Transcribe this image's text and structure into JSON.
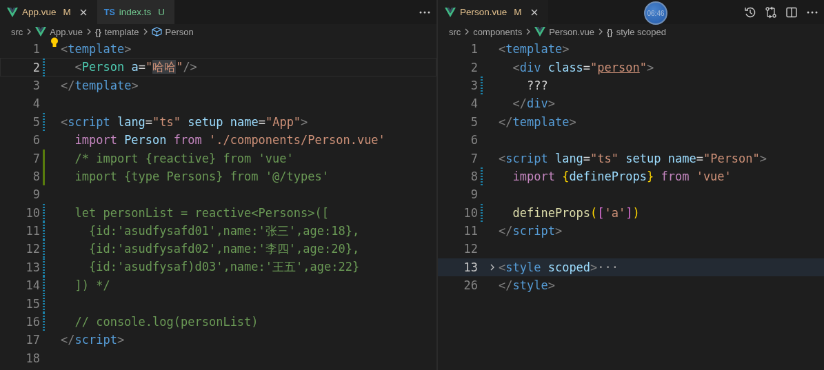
{
  "panes": [
    {
      "tabs": [
        {
          "kind": "vue",
          "label": "App.vue",
          "status": "M",
          "selected": true
        },
        {
          "kind": "ts",
          "icon_label": "TS",
          "label": "index.ts",
          "status": "U",
          "selected": false
        }
      ],
      "actions": [
        {
          "kind": "more"
        }
      ],
      "breadcrumbs": [
        {
          "kind": "folder",
          "text": "src"
        },
        {
          "kind": "vue",
          "text": "App.vue"
        },
        {
          "kind": "symbol",
          "symbol": "{}",
          "text": "template"
        },
        {
          "kind": "component",
          "text": "Person"
        }
      ],
      "lines": [
        {
          "number": "1",
          "lightbulb": true,
          "tokens": [
            {
              "text": "<",
              "kind": "punct"
            },
            {
              "text": "template",
              "kind": "tag"
            },
            {
              "text": ">",
              "kind": "punct"
            }
          ]
        },
        {
          "number": "2",
          "current": true,
          "git_modified": true,
          "tokens": [
            {
              "text": "  <",
              "kind": "punct"
            },
            {
              "text": "Person",
              "kind": "component"
            },
            {
              "text": " a",
              "kind": "attr"
            },
            {
              "text": "=",
              "kind": "plain"
            },
            {
              "text": "\"",
              "kind": "str"
            },
            {
              "text": "哈哈",
              "kind": "strhl"
            },
            {
              "text": "\"",
              "kind": "str"
            },
            {
              "text": "/>",
              "kind": "punct"
            }
          ]
        },
        {
          "number": "3",
          "tokens": [
            {
              "text": "</",
              "kind": "punct"
            },
            {
              "text": "template",
              "kind": "tag"
            },
            {
              "text": ">",
              "kind": "punct"
            }
          ]
        },
        {
          "number": "4"
        },
        {
          "number": "5",
          "git_modified": true,
          "tokens": [
            {
              "text": "<",
              "kind": "punct"
            },
            {
              "text": "script",
              "kind": "tag"
            },
            {
              "text": " lang",
              "kind": "attr"
            },
            {
              "text": "=",
              "kind": "plain"
            },
            {
              "text": "\"ts\"",
              "kind": "str"
            },
            {
              "text": " setup",
              "kind": "attr"
            },
            {
              "text": " name",
              "kind": "attr"
            },
            {
              "text": "=",
              "kind": "plain"
            },
            {
              "text": "\"App\"",
              "kind": "str"
            },
            {
              "text": ">",
              "kind": "punct"
            }
          ]
        },
        {
          "number": "6",
          "tokens": [
            {
              "text": "  import",
              "kind": "kw"
            },
            {
              "text": " Person",
              "kind": "ident"
            },
            {
              "text": " from",
              "kind": "kw"
            },
            {
              "text": " './components/Person.vue'",
              "kind": "str"
            }
          ]
        },
        {
          "number": "7",
          "git_added": true,
          "tokens": [
            {
              "text": "  /* import {reactive} from 'vue'",
              "kind": "comment"
            }
          ]
        },
        {
          "number": "8",
          "git_added": true,
          "tokens": [
            {
              "text": "  import {type Persons} from '@/types'",
              "kind": "comment"
            }
          ]
        },
        {
          "number": "9"
        },
        {
          "number": "10",
          "git_modified": true,
          "tokens": [
            {
              "text": "  let personList = reactive<Persons>([",
              "kind": "comment"
            }
          ]
        },
        {
          "number": "11",
          "git_modified": true,
          "tokens": [
            {
              "text": "    {id:'asudfysafd01',name:'张三',age:18},",
              "kind": "comment"
            }
          ]
        },
        {
          "number": "12",
          "git_modified": true,
          "tokens": [
            {
              "text": "    {id:'asudfysafd02',name:'李四',age:20},",
              "kind": "comment"
            }
          ]
        },
        {
          "number": "13",
          "git_modified": true,
          "tokens": [
            {
              "text": "    {id:'asudfysaf)d03',name:'王五',age:22}",
              "kind": "comment"
            }
          ]
        },
        {
          "number": "14",
          "git_modified": true,
          "tokens": [
            {
              "text": "  ]) */",
              "kind": "comment"
            }
          ]
        },
        {
          "number": "15",
          "git_modified": true
        },
        {
          "number": "16",
          "git_modified": true,
          "tokens": [
            {
              "text": "  // console.log(personList)",
              "kind": "comment"
            }
          ]
        },
        {
          "number": "17",
          "tokens": [
            {
              "text": "</",
              "kind": "punct"
            },
            {
              "text": "script",
              "kind": "tag"
            },
            {
              "text": ">",
              "kind": "punct"
            }
          ]
        },
        {
          "number": "18"
        }
      ]
    },
    {
      "tabs": [
        {
          "kind": "vue",
          "label": "Person.vue",
          "status": "M",
          "selected": true
        }
      ],
      "actions": [
        {
          "kind": "history"
        },
        {
          "kind": "compare"
        },
        {
          "kind": "split"
        },
        {
          "kind": "more"
        }
      ],
      "timer": "06:46",
      "breadcrumbs": [
        {
          "kind": "folder",
          "text": "src"
        },
        {
          "kind": "folder",
          "text": "components"
        },
        {
          "kind": "vue",
          "text": "Person.vue"
        },
        {
          "kind": "symbol",
          "symbol": "{}",
          "text": "style scoped"
        }
      ],
      "lines": [
        {
          "number": "1",
          "tokens": [
            {
              "text": "<",
              "kind": "punct"
            },
            {
              "text": "template",
              "kind": "tag"
            },
            {
              "text": ">",
              "kind": "punct"
            }
          ]
        },
        {
          "number": "2",
          "tokens": [
            {
              "text": "  <",
              "kind": "punct"
            },
            {
              "text": "div",
              "kind": "tag"
            },
            {
              "text": " class",
              "kind": "attr"
            },
            {
              "text": "=",
              "kind": "plain"
            },
            {
              "text": "\"",
              "kind": "str"
            },
            {
              "text": "person",
              "kind": "strlink"
            },
            {
              "text": "\"",
              "kind": "str"
            },
            {
              "text": ">",
              "kind": "punct"
            }
          ]
        },
        {
          "number": "3",
          "git_modified": true,
          "tokens": [
            {
              "text": "    ???",
              "kind": "plain"
            }
          ]
        },
        {
          "number": "4",
          "tokens": [
            {
              "text": "  </",
              "kind": "punct"
            },
            {
              "text": "div",
              "kind": "tag"
            },
            {
              "text": ">",
              "kind": "punct"
            }
          ]
        },
        {
          "number": "5",
          "tokens": [
            {
              "text": "</",
              "kind": "punct"
            },
            {
              "text": "template",
              "kind": "tag"
            },
            {
              "text": ">",
              "kind": "punct"
            }
          ]
        },
        {
          "number": "6"
        },
        {
          "number": "7",
          "tokens": [
            {
              "text": "<",
              "kind": "punct"
            },
            {
              "text": "script",
              "kind": "tag"
            },
            {
              "text": " lang",
              "kind": "attr"
            },
            {
              "text": "=",
              "kind": "plain"
            },
            {
              "text": "\"ts\"",
              "kind": "str"
            },
            {
              "text": " setup",
              "kind": "attr"
            },
            {
              "text": " name",
              "kind": "attr"
            },
            {
              "text": "=",
              "kind": "plain"
            },
            {
              "text": "\"Person\"",
              "kind": "str"
            },
            {
              "text": ">",
              "kind": "punct"
            }
          ]
        },
        {
          "number": "8",
          "git_modified": true,
          "tokens": [
            {
              "text": "  import",
              "kind": "kw"
            },
            {
              "text": " {",
              "kind": "brace"
            },
            {
              "text": "defineProps",
              "kind": "ident"
            },
            {
              "text": "}",
              "kind": "brace"
            },
            {
              "text": " from",
              "kind": "kw"
            },
            {
              "text": " 'vue'",
              "kind": "str"
            }
          ]
        },
        {
          "number": "9"
        },
        {
          "number": "10",
          "git_modified": true,
          "tokens": [
            {
              "text": "  defineProps",
              "kind": "func"
            },
            {
              "text": "(",
              "kind": "brace"
            },
            {
              "text": "[",
              "kind": "brace2"
            },
            {
              "text": "'a'",
              "kind": "str"
            },
            {
              "text": "]",
              "kind": "brace2"
            },
            {
              "text": ")",
              "kind": "brace"
            }
          ]
        },
        {
          "number": "11",
          "tokens": [
            {
              "text": "</",
              "kind": "punct"
            },
            {
              "text": "script",
              "kind": "tag"
            },
            {
              "text": ">",
              "kind": "punct"
            }
          ]
        },
        {
          "number": "12"
        },
        {
          "number": "13",
          "current": true,
          "folded": true,
          "tokens": [
            {
              "text": "<",
              "kind": "punct"
            },
            {
              "text": "style",
              "kind": "tag"
            },
            {
              "text": " scoped",
              "kind": "attr"
            },
            {
              "text": ">",
              "kind": "punct"
            },
            {
              "text": "···",
              "kind": "fold"
            }
          ]
        },
        {
          "number": "26",
          "tokens": [
            {
              "text": "</",
              "kind": "punct"
            },
            {
              "text": "style",
              "kind": "tag"
            },
            {
              "text": ">",
              "kind": "punct"
            }
          ]
        }
      ]
    }
  ]
}
